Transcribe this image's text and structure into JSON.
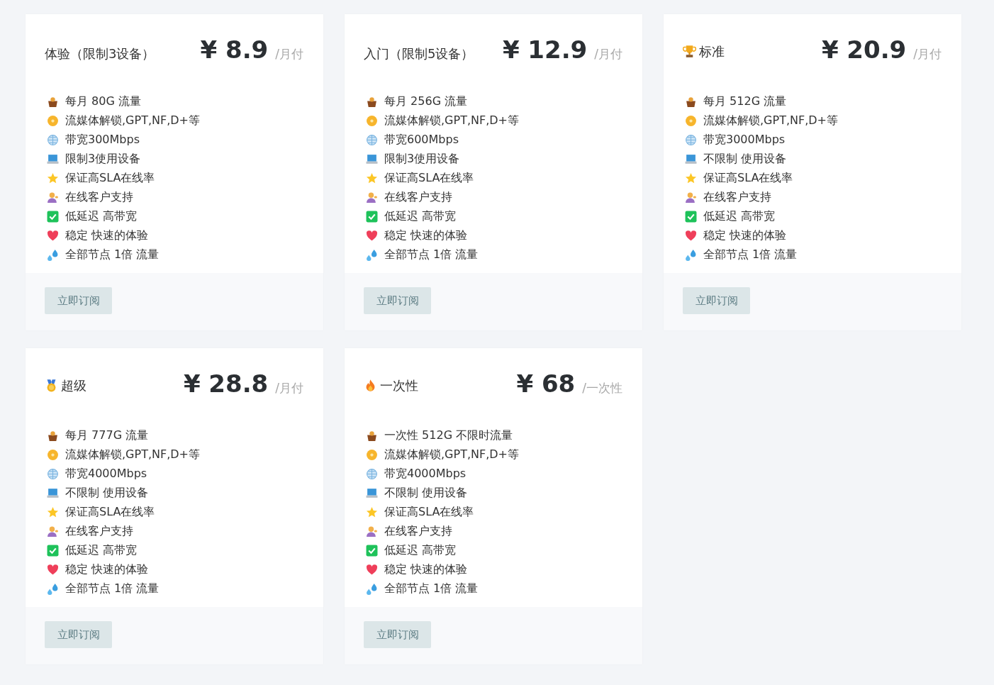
{
  "plans": [
    {
      "title": {
        "text": "体验（限制3设备）"
      },
      "price": "¥ 8.9",
      "period": "/月付",
      "features": [
        {
          "kind": "basket",
          "text": "每月 80G 流量"
        },
        {
          "kind": "disc",
          "text": "流媒体解锁,GPT,NF,D+等"
        },
        {
          "kind": "globe",
          "text": "带宽300Mbps"
        },
        {
          "kind": "laptop",
          "text": "限制3使用设备"
        },
        {
          "kind": "star",
          "text": "保证高SLA在线率"
        },
        {
          "kind": "person",
          "text": "在线客户支持"
        },
        {
          "kind": "check",
          "text": "低延迟 高带宽"
        },
        {
          "kind": "heart",
          "text": "稳定 快速的体验"
        },
        {
          "kind": "drops",
          "text": "全部节点 1倍 流量"
        }
      ],
      "button": "立即订阅"
    },
    {
      "title": {
        "text": "入门（限制5设备）"
      },
      "price": "¥ 12.9",
      "period": "/月付",
      "features": [
        {
          "kind": "basket",
          "text": "每月 256G 流量"
        },
        {
          "kind": "disc",
          "text": "流媒体解锁,GPT,NF,D+等"
        },
        {
          "kind": "globe",
          "text": "带宽600Mbps"
        },
        {
          "kind": "laptop",
          "text": "限制3使用设备"
        },
        {
          "kind": "star",
          "text": "保证高SLA在线率"
        },
        {
          "kind": "person",
          "text": "在线客户支持"
        },
        {
          "kind": "check",
          "text": "低延迟 高带宽"
        },
        {
          "kind": "heart",
          "text": "稳定 快速的体验"
        },
        {
          "kind": "drops",
          "text": "全部节点 1倍 流量"
        }
      ],
      "button": "立即订阅"
    },
    {
      "title": {
        "kind": "trophy",
        "text": "标准"
      },
      "price": "¥ 20.9",
      "period": "/月付",
      "features": [
        {
          "kind": "basket",
          "text": "每月 512G 流量"
        },
        {
          "kind": "disc",
          "text": "流媒体解锁,GPT,NF,D+等"
        },
        {
          "kind": "globe",
          "text": "带宽3000Mbps"
        },
        {
          "kind": "laptop",
          "text": "不限制 使用设备"
        },
        {
          "kind": "star",
          "text": "保证高SLA在线率"
        },
        {
          "kind": "person",
          "text": "在线客户支持"
        },
        {
          "kind": "check",
          "text": "低延迟 高带宽"
        },
        {
          "kind": "heart",
          "text": "稳定 快速的体验"
        },
        {
          "kind": "drops",
          "text": "全部节点 1倍 流量"
        }
      ],
      "button": "立即订阅"
    },
    {
      "title": {
        "kind": "medal",
        "text": "超级"
      },
      "price": "¥ 28.8",
      "period": "/月付",
      "features": [
        {
          "kind": "basket",
          "text": "每月 777G 流量"
        },
        {
          "kind": "disc",
          "text": "流媒体解锁,GPT,NF,D+等"
        },
        {
          "kind": "globe",
          "text": "带宽4000Mbps"
        },
        {
          "kind": "laptop",
          "text": "不限制 使用设备"
        },
        {
          "kind": "star",
          "text": "保证高SLA在线率"
        },
        {
          "kind": "person",
          "text": "在线客户支持"
        },
        {
          "kind": "check",
          "text": "低延迟 高带宽"
        },
        {
          "kind": "heart",
          "text": "稳定 快速的体验"
        },
        {
          "kind": "drops",
          "text": "全部节点 1倍 流量"
        }
      ],
      "button": "立即订阅"
    },
    {
      "title": {
        "kind": "fire",
        "text": "一次性"
      },
      "price": "¥ 68",
      "period": "/一次性",
      "features": [
        {
          "kind": "basket",
          "text": "一次性 512G 不限时流量"
        },
        {
          "kind": "disc",
          "text": "流媒体解锁,GPT,NF,D+等"
        },
        {
          "kind": "globe",
          "text": "带宽4000Mbps"
        },
        {
          "kind": "laptop",
          "text": "不限制 使用设备"
        },
        {
          "kind": "star",
          "text": "保证高SLA在线率"
        },
        {
          "kind": "person",
          "text": "在线客户支持"
        },
        {
          "kind": "check",
          "text": "低延迟 高带宽"
        },
        {
          "kind": "heart",
          "text": "稳定 快速的体验"
        },
        {
          "kind": "drops",
          "text": "全部节点 1倍 流量"
        }
      ],
      "button": "立即订阅"
    }
  ]
}
